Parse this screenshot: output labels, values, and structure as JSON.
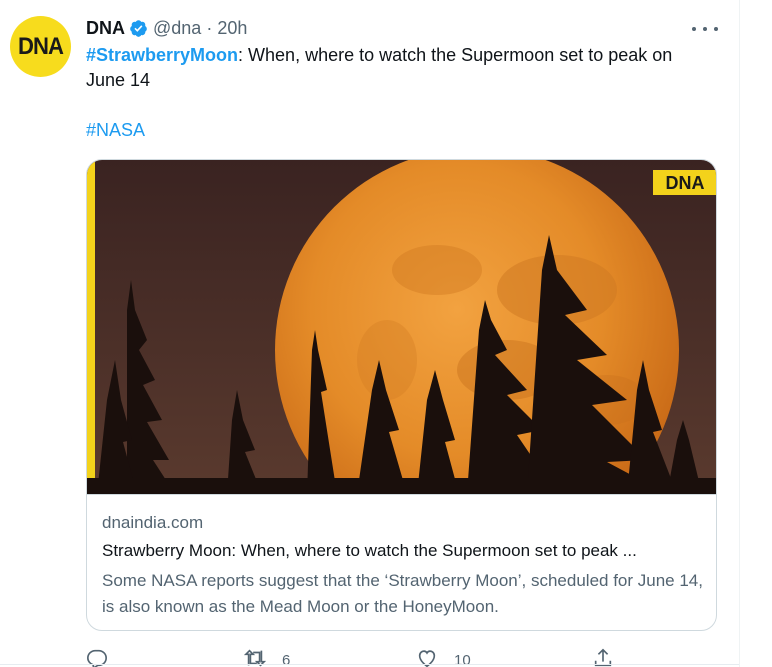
{
  "tweet": {
    "avatar_text": "DNA",
    "author_name": "DNA",
    "handle": "@dna",
    "separator": "·",
    "time": "20h",
    "hashtag_main": "#StrawberryMoon",
    "text_rest": ": When, where to watch the Supermoon set to peak on",
    "text_line2": "June 14",
    "hashtag_second": "#NASA"
  },
  "card": {
    "image_watermark": "DNA",
    "domain": "dnaindia.com",
    "title": "Strawberry Moon: When, where to watch the Supermoon set to peak ...",
    "description": "Some NASA reports suggest that the ‘Strawberry Moon’, scheduled for June 14, is also known as the Mead Moon or the HoneyMoon."
  },
  "actions": {
    "reply_count": "",
    "retweet_count": "6",
    "like_count": "10",
    "share_count": ""
  },
  "icons": {
    "verified": "verified-badge-icon",
    "more": "more-horizontal-icon",
    "reply": "reply-icon",
    "retweet": "retweet-icon",
    "like": "heart-icon",
    "share": "share-icon"
  },
  "colors": {
    "accent": "#1d9bf0",
    "avatar_bg": "#f7dc1d",
    "secondary_text": "#536471",
    "moon": "#e8912c",
    "sky": "#3b2422"
  }
}
